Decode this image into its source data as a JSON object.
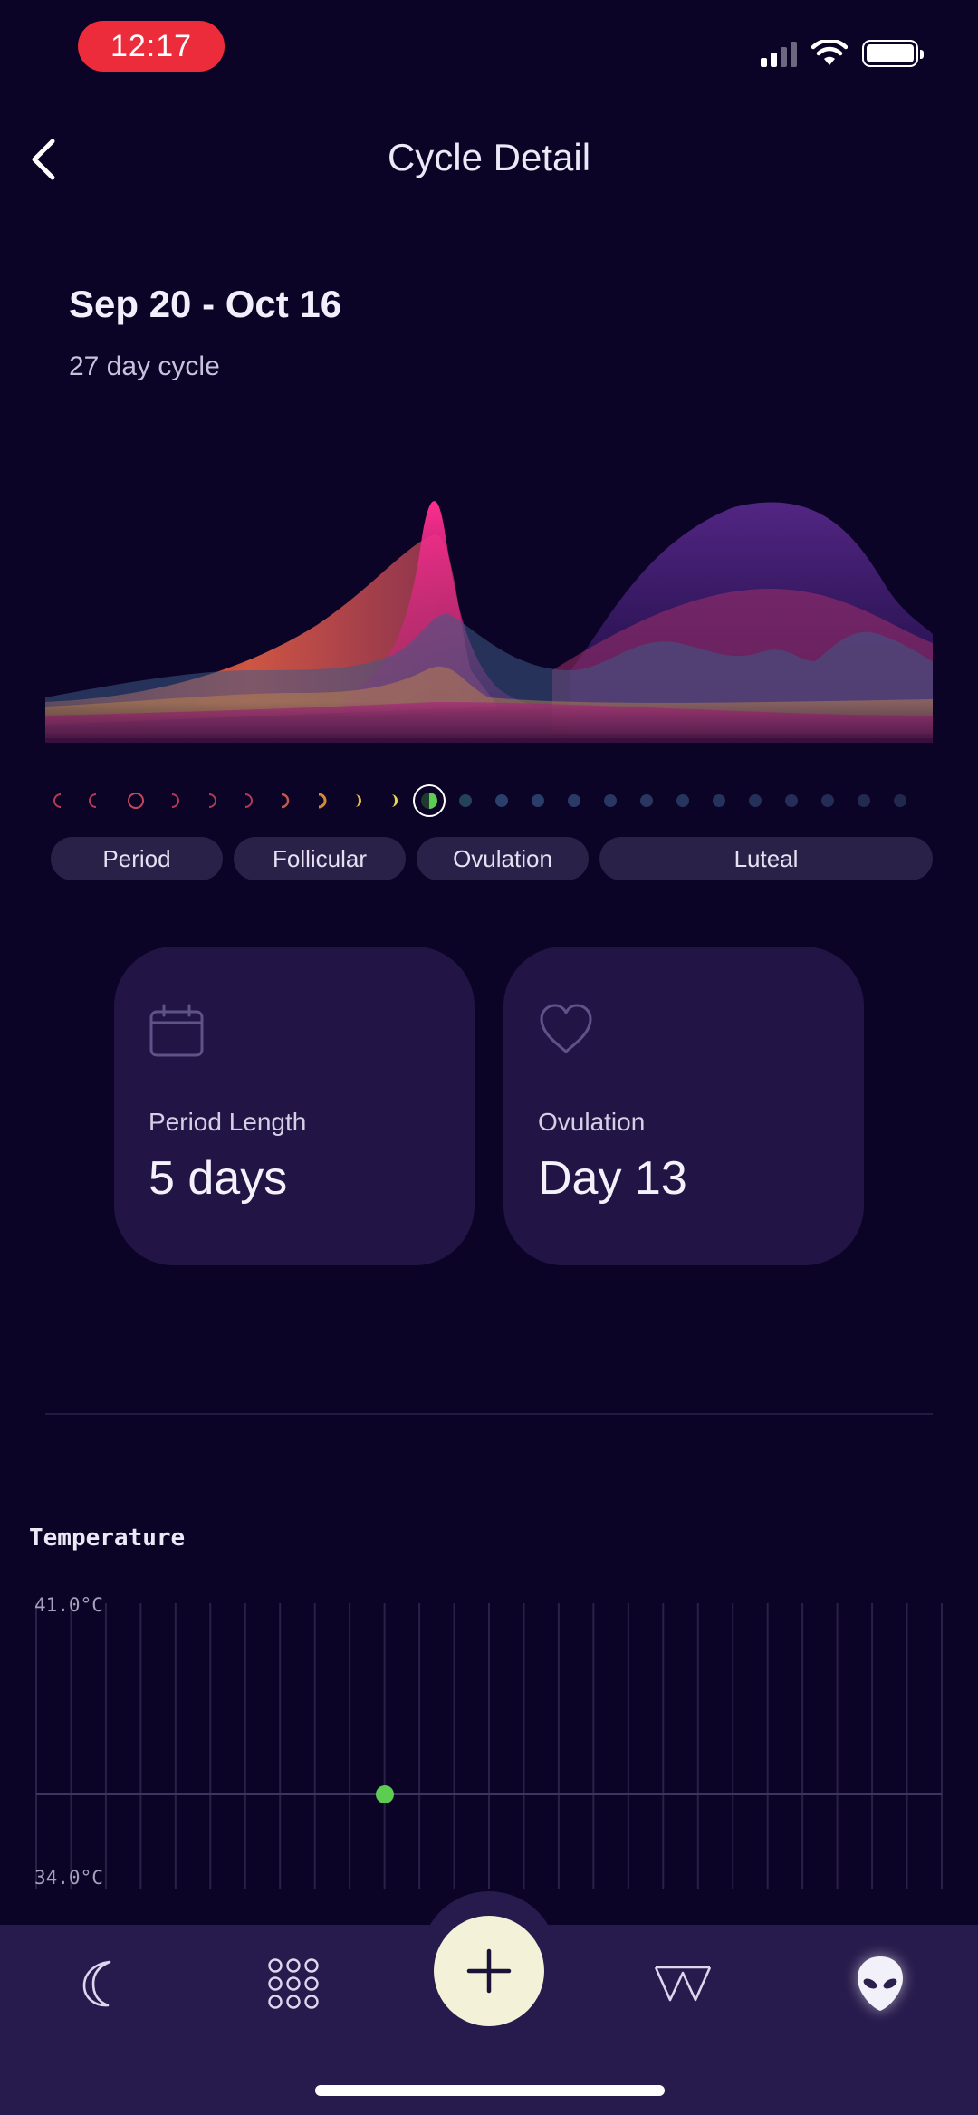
{
  "status_bar": {
    "time": "12:17"
  },
  "header": {
    "title": "Cycle Detail"
  },
  "cycle": {
    "date_range": "Sep 20 - Oct 16",
    "length_text": "27 day cycle"
  },
  "phases": [
    {
      "label": "Period"
    },
    {
      "label": "Follicular"
    },
    {
      "label": "Ovulation"
    },
    {
      "label": "Luteal"
    }
  ],
  "cards": {
    "period": {
      "label": "Period Length",
      "value": "5 days",
      "icon": "calendar-icon"
    },
    "ovulation": {
      "label": "Ovulation",
      "value": "Day 13",
      "icon": "heart-icon"
    }
  },
  "temperature": {
    "title": "Temperature",
    "y_max_label": "41.0°C",
    "y_min_label": "34.0°C"
  },
  "tabbar": {
    "items": [
      "moon-icon",
      "grid-icon",
      "add-icon",
      "w-logo-icon",
      "alien-icon"
    ]
  },
  "colors": {
    "background": "#0c0426",
    "card": "#221545",
    "tabbar": "#271a4c",
    "fab": "#f3f1d7",
    "time_pill": "#ec2c3a",
    "data_point": "#5ccc53"
  }
}
